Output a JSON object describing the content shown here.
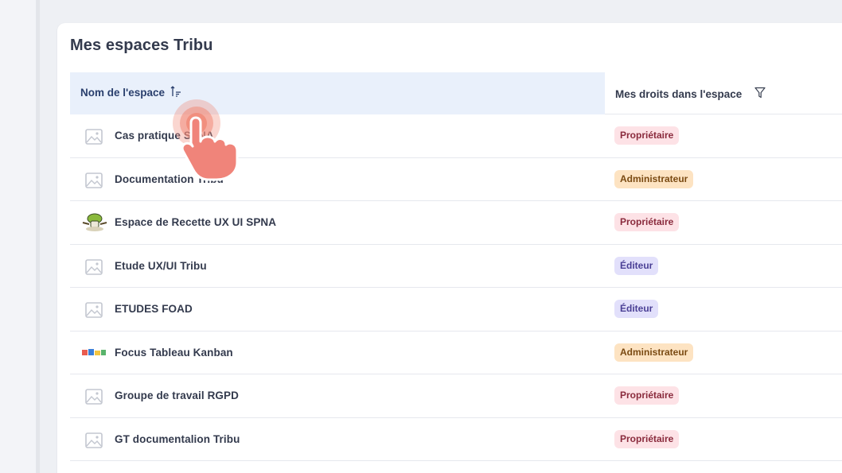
{
  "card": {
    "title": "Mes espaces Tribu"
  },
  "table": {
    "headers": {
      "name": "Nom de l'espace",
      "rights": "Mes droits dans l'espace"
    },
    "rows": [
      {
        "name": "Cas pratique SPNA",
        "icon": "image-placeholder-icon",
        "role": "Propriétaire",
        "role_kind": "proprietaire"
      },
      {
        "name": "Documentation Tribu",
        "icon": "image-placeholder-icon",
        "role": "Administrateur",
        "role_kind": "administrateur"
      },
      {
        "name": "Espace de Recette UX UI SPNA",
        "icon": "chef-logo-icon",
        "role": "Propriétaire",
        "role_kind": "proprietaire"
      },
      {
        "name": "Etude UX/UI Tribu",
        "icon": "image-placeholder-icon",
        "role": "Éditeur",
        "role_kind": "editeur"
      },
      {
        "name": "ETUDES FOAD",
        "icon": "image-placeholder-icon",
        "role": "Éditeur",
        "role_kind": "editeur"
      },
      {
        "name": "Focus Tableau Kanban",
        "icon": "kanban-logo-icon",
        "role": "Administrateur",
        "role_kind": "administrateur"
      },
      {
        "name": "Groupe de travail RGPD",
        "icon": "image-placeholder-icon",
        "role": "Propriétaire",
        "role_kind": "proprietaire"
      },
      {
        "name": "GT documentalion Tribu",
        "icon": "image-placeholder-icon",
        "role": "Propriétaire",
        "role_kind": "proprietaire"
      }
    ]
  },
  "colors": {
    "proprietaire_bg": "#fde2e6",
    "administrateur_bg": "#fde3c2",
    "editeur_bg": "#e2e0fb",
    "header_highlight": "#e9f0fb",
    "cursor_accent": "#f08a78"
  },
  "overlay": {
    "cursor": "tap-hand-cursor-icon"
  }
}
